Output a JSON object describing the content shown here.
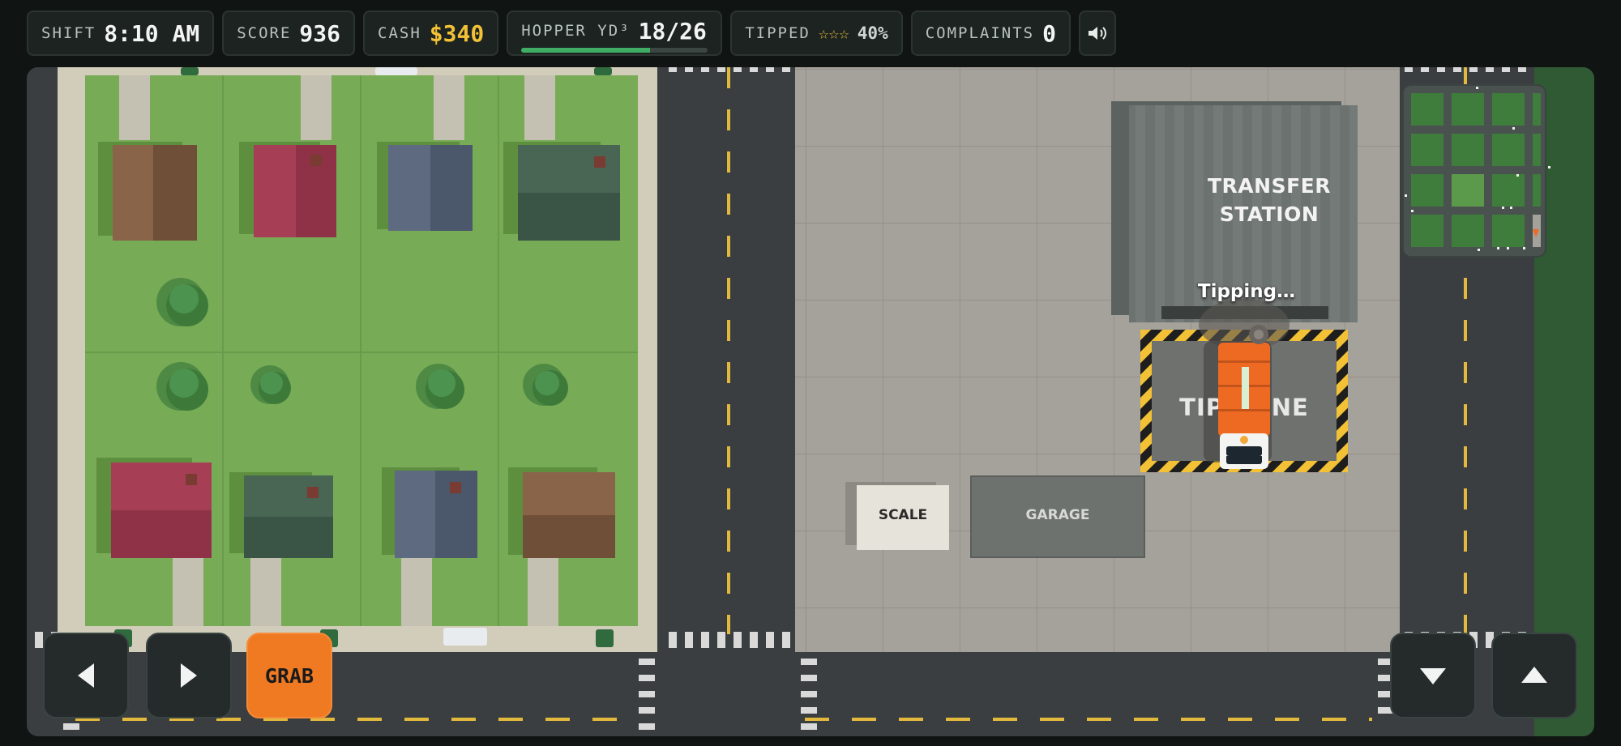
{
  "hud": {
    "shift_label": "SHIFT",
    "shift_value": "8:10 AM",
    "score_label": "SCORE",
    "score_value": "936",
    "cash_label": "CASH",
    "cash_value": "$340",
    "hopper_label": "HOPPER YD³",
    "hopper_value": "18/26",
    "hopper_fill_fraction": 0.6923,
    "tipped_label": "TIPPED",
    "tipped_stars": "☆☆☆",
    "tipped_value": "40%",
    "complaints_label": "COMPLAINTS",
    "complaints_value": "0",
    "sound_icon": "speaker-icon"
  },
  "map": {
    "transfer_station_line1": "TRANSFER",
    "transfer_station_line2": "STATION",
    "tipping_status": "Tipping…",
    "tip_zone_label": "TIP ZONE",
    "scale_label": "SCALE",
    "garage_label": "GARAGE"
  },
  "controls": {
    "left_icon": "arrow-left-icon",
    "right_icon": "arrow-right-icon",
    "grab_label": "GRAB",
    "down_icon": "arrow-down-icon",
    "up_icon": "arrow-up-icon"
  },
  "colors": {
    "grass": "#78ab56",
    "asphalt": "#3a3e41",
    "lot": "#a5a19b",
    "truck": "#ee6a22",
    "hazard": "#f2c136",
    "accent_gold": "#f2c136",
    "hopper_bar": "#3fae64"
  }
}
